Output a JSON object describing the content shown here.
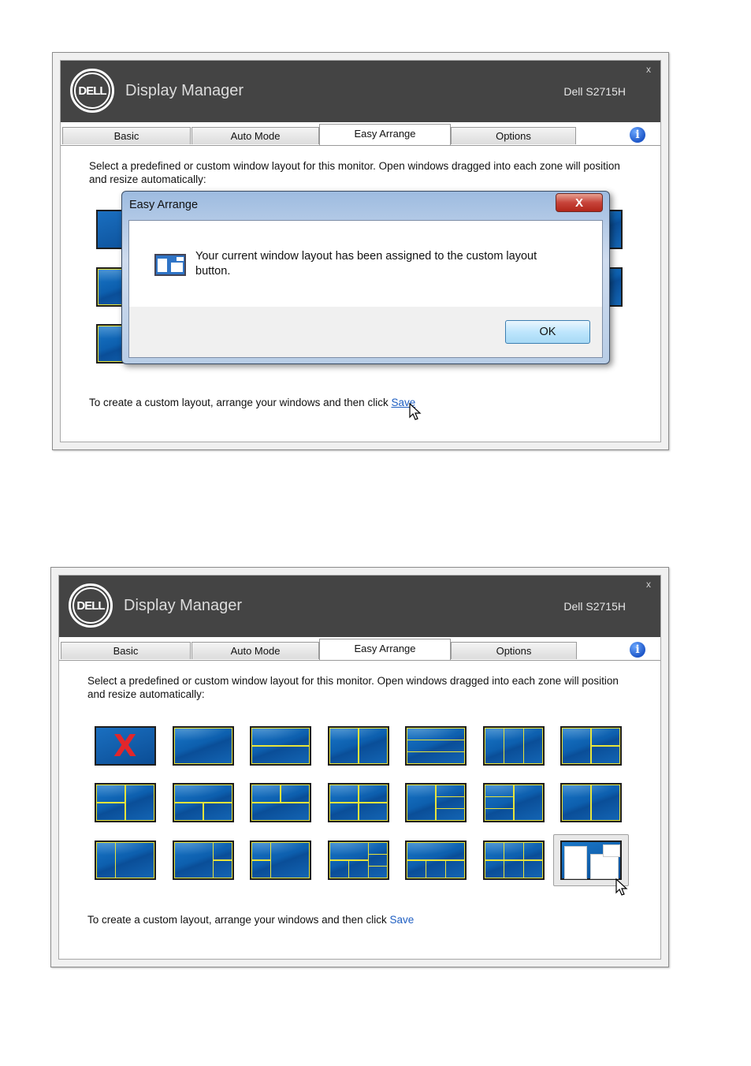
{
  "window": {
    "app_title": "Display Manager",
    "brand": "DELL",
    "model": "Dell S2715H",
    "close": "x"
  },
  "tabs": [
    {
      "label": "Basic"
    },
    {
      "label": "Auto Mode"
    },
    {
      "label": "Easy Arrange",
      "active": true
    },
    {
      "label": "Options"
    }
  ],
  "info_icon": "i",
  "description": "Select a predefined or custom window layout for this monitor. Open windows dragged into each zone will position and resize automatically:",
  "footer": {
    "text": "To create a custom layout, arrange your windows and then click ",
    "save_label": "Save"
  },
  "dialog": {
    "title": "Easy Arrange",
    "close": "X",
    "message": "Your current window layout has been assigned to the custom layout button.",
    "ok_label": "OK"
  },
  "layout_grid": {
    "rows": 3,
    "columns": 7,
    "first_layout_icon": "X",
    "last_layout": "custom-layout"
  },
  "colors": {
    "titlebar": "#444444",
    "link": "#1f5fc2",
    "zone_border": "#e8e43a",
    "thumb_blue": "#0d5fae",
    "disabled_x": "#e2262b"
  }
}
